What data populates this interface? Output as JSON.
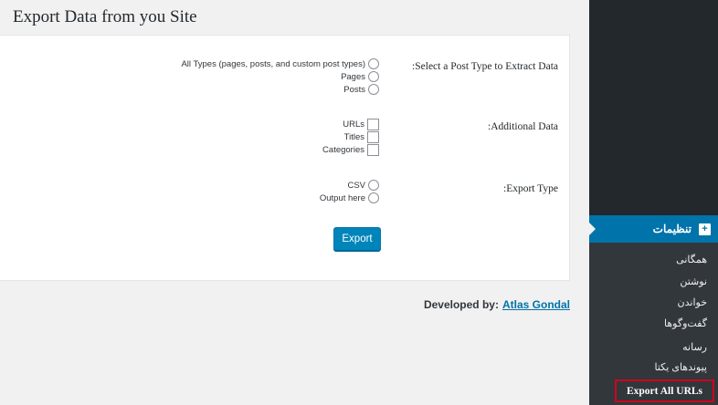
{
  "page": {
    "title": "Export Data from you Site"
  },
  "form": {
    "post_type": {
      "label": "Select a Post Type to Extract Data:",
      "options": [
        "All Types (pages, posts, and custom post types)",
        "Pages",
        "Posts"
      ]
    },
    "additional_data": {
      "label": "Additional Data:",
      "options": [
        "URLs",
        "Titles",
        "Categories"
      ]
    },
    "export_type": {
      "label": "Export Type:",
      "options": [
        "CSV",
        "Output here"
      ]
    },
    "export_button": "Export"
  },
  "footer": {
    "developed_by": "Developed by:",
    "author_link": "Atlas Gondal"
  },
  "sidebar": {
    "menu_title": "تنظیمات",
    "menu_icon": "settings-plus-icon",
    "items": [
      "همگانی",
      "نوشتن",
      "خواندن",
      "گفت‌وگوها",
      "رسانه",
      "پیوندهای یکتا",
      "Export All URLs"
    ],
    "current_item": "Export All URLs",
    "highlight_color": "#d0021b",
    "accent_color": "#0073aa"
  }
}
